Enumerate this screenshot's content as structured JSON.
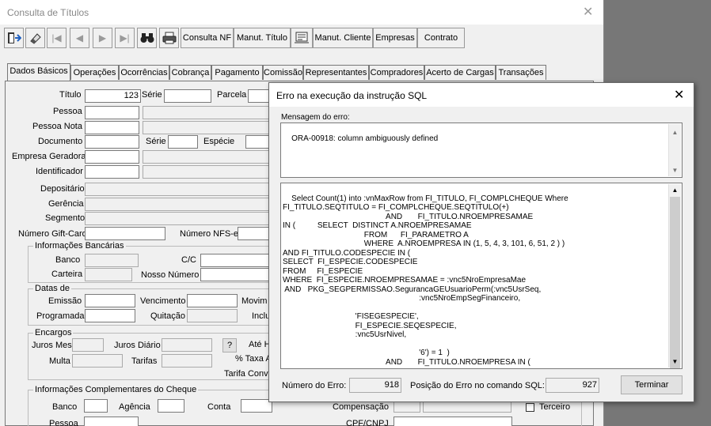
{
  "window": {
    "title": "Consulta de Títulos"
  },
  "toolbar": {
    "icons": [
      "exit-icon",
      "eraser-icon",
      "first-record-icon",
      "prev-record-icon",
      "next-record-icon",
      "last-record-icon",
      "binoculars-icon",
      "printer-icon"
    ],
    "buttons": [
      "Consulta NF",
      "Manut. Título",
      "Manut. Cliente",
      "Empresas",
      "Contrato"
    ]
  },
  "tabs": [
    "Dados Básicos",
    "Operações",
    "Ocorrências",
    "Cobrança",
    "Pagamento",
    "Comissão",
    "Representantes",
    "Compradores",
    "Acerto de Cargas",
    "Transações"
  ],
  "form": {
    "titulo_label": "Título",
    "titulo_value": "123",
    "serie_label": "Série",
    "parcela_label": "Parcela",
    "pessoa_label": "Pessoa",
    "pessoa_nota_label": "Pessoa Nota",
    "documento_label": "Documento",
    "serie2_label": "Série",
    "especie_label": "Espécie",
    "empresa_geradora_label": "Empresa Geradora",
    "identificador_label": "Identificador",
    "depositario_label": "Depositário",
    "gerencia_label": "Gerência",
    "segmento_label": "Segmento",
    "gift_card_label": "Número Gift-Card",
    "nfse_label": "Número NFS-e",
    "banc_group": "Informações Bancárias",
    "banco_label": "Banco",
    "cc_label": "C/C",
    "carteira_label": "Carteira",
    "nosso_numero_label": "Nosso Número",
    "datas_group": "Datas de",
    "emissao_label": "Emissão",
    "vencimento_label": "Vencimento",
    "movim_label": "Movim",
    "programada_label": "Programada",
    "quitacao_label": "Quitação",
    "inclu_label": "Inclu",
    "encargos_group": "Encargos",
    "juros_mes_label": "Juros Mes",
    "juros_diario_label": "Juros Diário",
    "q_button": "?",
    "ate_label": "Até H",
    "multa_label": "Multa",
    "tarifas_label": "Tarifas",
    "taxa_label": "% Taxa A",
    "tarifa_conv_label": "Tarifa Convê",
    "cheque_group": "Informações Complementares do Cheque",
    "banco2_label": "Banco",
    "agencia_label": "Agência",
    "conta_label": "Conta",
    "compensacao_label": "Compensação",
    "terceiro_label": "Terceiro",
    "pessoa2_label": "Pessoa",
    "cpf_label": "CPF/CNPJ"
  },
  "dialog": {
    "title": "Erro na execução da instrução SQL",
    "msg_label": "Mensagem do erro:",
    "message": "ORA-00918: column ambiguously defined",
    "sql": "Select Count(1) into :vnMaxRow from FI_TITULO, FI_COMPLCHEQUE Where\nFI_TITULO.SEQTITULO = FI_COMPLCHEQUE.SEQTITULO(+)\n                                               AND       FI_TITULO.NROEMPRESAMAE\nIN (          SELECT  DISTINCT A.NROEMPRESAMAE\n                                     FROM      FI_PARAMETRO A\n                                     WHERE  A.NROEMPRESA IN (1, 5, 4, 3, 101, 6, 51, 2 ) )\nAND FI_TITULO.CODESPECIE IN (\nSELECT  FI_ESPECIE.CODESPECIE\nFROM     FI_ESPECIE\nWHERE  FI_ESPECIE.NROEMPRESAMAE = :vnc5NroEmpresaMae\n AND   PKG_SEGPERMISSAO.SegurancaGEUsuarioPerm(:vnc5UsrSeq,\n                                                              :vnc5NroEmpSegFinanceiro,\n\n                                 'FISEGESPECIE',\n                                 FI_ESPECIE.SEQESPECIE,\n                                 :vnc5UsrNivel,\n\n                                                              '6') = 1  )\n                                               AND       FI_TITULO.NROEMPRESA IN (",
    "num_erro_label": "Número do Erro:",
    "num_erro_value": "918",
    "posicao_label": "Posição do Erro no comando SQL:",
    "posicao_value": "927",
    "terminar_label": "Terminar"
  }
}
